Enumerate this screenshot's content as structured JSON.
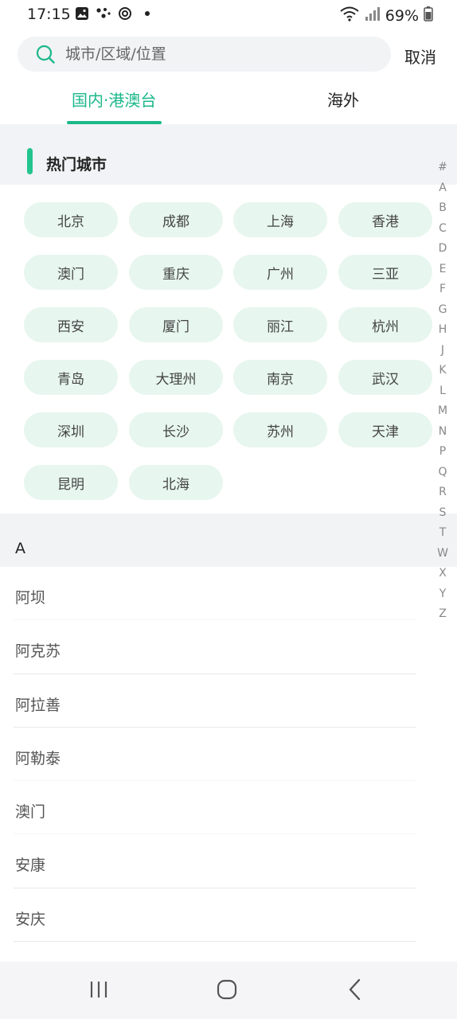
{
  "status_bar": {
    "time": "17:15",
    "battery": "69%",
    "icons_left": [
      "gallery-icon",
      "dots-icon",
      "sync-icon",
      "dot-icon"
    ],
    "icons_right": [
      "wifi-icon",
      "signal-icon",
      "battery-icon"
    ]
  },
  "search": {
    "placeholder": "城市/区域/位置",
    "cancel_label": "取消"
  },
  "tabs": [
    {
      "label": "国内·港澳台",
      "active": true
    },
    {
      "label": "海外",
      "active": false
    }
  ],
  "hot": {
    "title": "热门城市",
    "cities": [
      "北京",
      "成都",
      "上海",
      "香港",
      "澳门",
      "重庆",
      "广州",
      "三亚",
      "西安",
      "厦门",
      "丽江",
      "杭州",
      "青岛",
      "大理州",
      "南京",
      "武汉",
      "深圳",
      "长沙",
      "苏州",
      "天津",
      "昆明",
      "北海"
    ]
  },
  "section": {
    "letter": "A",
    "items": [
      "阿坝",
      "阿克苏",
      "阿拉善",
      "阿勒泰",
      "澳门",
      "安康",
      "安庆"
    ]
  },
  "alpha_index": [
    "#",
    "A",
    "B",
    "C",
    "D",
    "E",
    "F",
    "G",
    "H",
    "J",
    "K",
    "L",
    "M",
    "N",
    "P",
    "Q",
    "R",
    "S",
    "T",
    "W",
    "X",
    "Y",
    "Z"
  ],
  "colors": {
    "accent": "#1cb88a",
    "chip_bg": "#e7f6ef",
    "header_bg": "#f1f3f6"
  }
}
